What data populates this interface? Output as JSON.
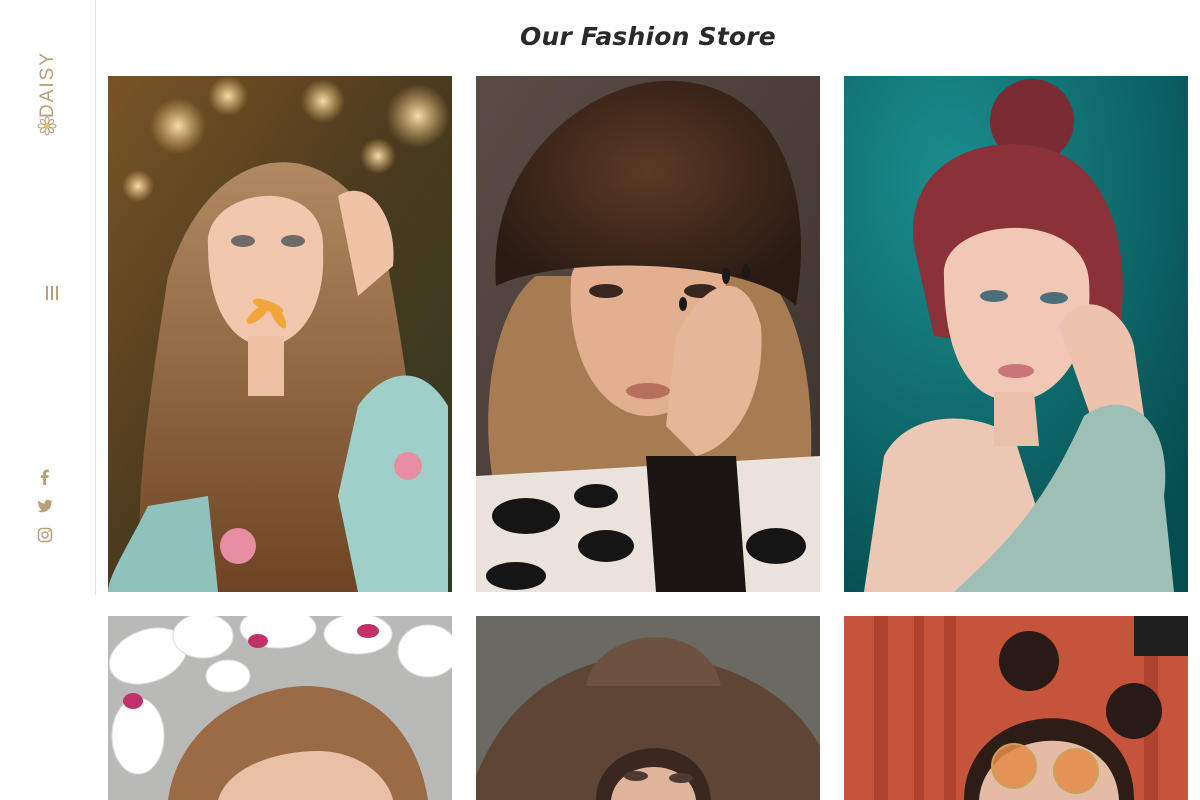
{
  "brand": {
    "name": "DAISY",
    "color": "#b8a07a"
  },
  "sidebar": {
    "menu_icon": "hamburger-vertical-icon",
    "social": [
      {
        "name": "facebook",
        "icon": "facebook-icon"
      },
      {
        "name": "twitter",
        "icon": "twitter-icon"
      },
      {
        "name": "instagram",
        "icon": "instagram-icon"
      }
    ]
  },
  "page": {
    "title": "Our Fashion Store"
  },
  "gallery": {
    "items": [
      {
        "id": "photo-1",
        "alt": "Woman with long wavy hair holding a flower in her mouth",
        "bg": "#6b4a2a"
      },
      {
        "id": "photo-2",
        "alt": "Woman in a brown fur hat with hand on face",
        "bg": "#4c3f3a"
      },
      {
        "id": "photo-3",
        "alt": "Red-haired woman with bun against teal background",
        "bg": "#0f6d6f"
      },
      {
        "id": "photo-4",
        "alt": "Woman with white orchids in her hair",
        "bg": "#c9c9c9"
      },
      {
        "id": "photo-5",
        "alt": "Woman in a wide brown felt hat",
        "bg": "#5a5550"
      },
      {
        "id": "photo-6",
        "alt": "Woman with double buns and round orange sunglasses",
        "bg": "#c8553d"
      }
    ]
  }
}
